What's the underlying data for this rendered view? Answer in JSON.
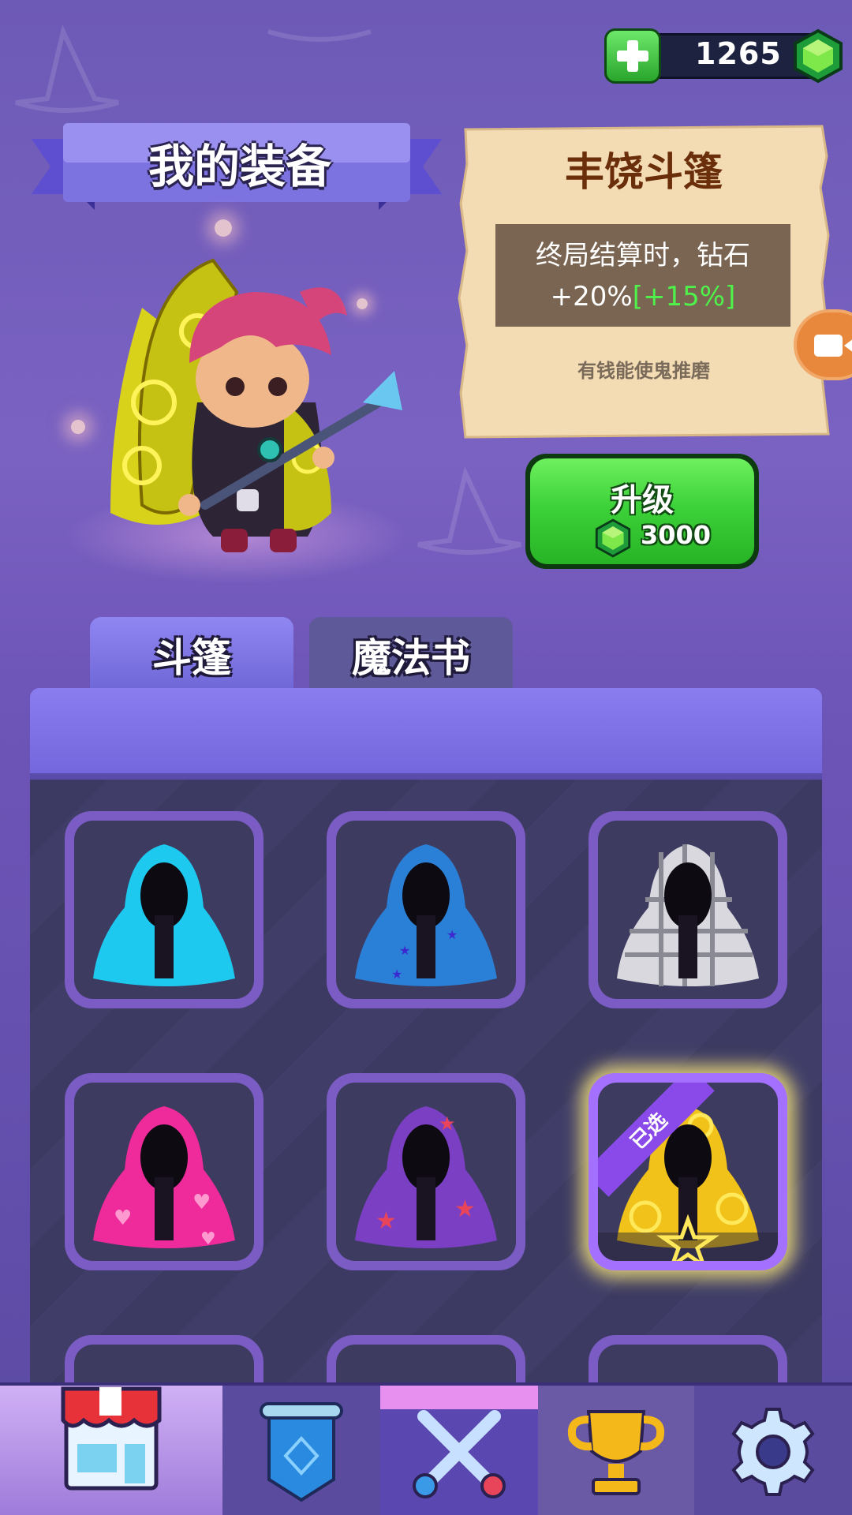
{
  "currency": {
    "gems": "1265",
    "add_label": "+"
  },
  "header": {
    "title": "我的装备"
  },
  "item_info": {
    "name": "丰饶斗篷",
    "description": "终局结算时，钻石",
    "bonus_base": "+20%",
    "bonus_extra": "[+15%]",
    "flavor": "有钱能使鬼推磨"
  },
  "upgrade": {
    "label": "升级",
    "cost": "3000"
  },
  "tabs": [
    {
      "label": "斗篷",
      "active": true
    },
    {
      "label": "魔法书",
      "active": false
    }
  ],
  "cloaks": [
    {
      "icon": "cyan-cloak-icon",
      "color": "#1ec9f0",
      "selected": false
    },
    {
      "icon": "blue-star-cloak-icon",
      "color": "#2a7fd6",
      "selected": false
    },
    {
      "icon": "plaid-cloak-icon",
      "color": "#cfcfd4",
      "selected": false
    },
    {
      "icon": "pink-heart-cloak-icon",
      "color": "#ef2a9a",
      "selected": false
    },
    {
      "icon": "purple-star-cloak-icon",
      "color": "#7b3fc4",
      "selected": false
    },
    {
      "icon": "gold-swirl-cloak-icon",
      "color": "#f0c21a",
      "selected": true,
      "tag": "已选"
    }
  ],
  "nav": [
    {
      "icon": "shop-icon",
      "active": true
    },
    {
      "icon": "banner-icon",
      "active": false
    },
    {
      "icon": "crossed-swords-icon",
      "active": false
    },
    {
      "icon": "trophy-icon",
      "active": false
    },
    {
      "icon": "gear-icon",
      "active": false
    }
  ],
  "colors": {
    "accent_green": "#3dd23a",
    "bonus_green": "#4ef24a",
    "panel_purple": "#7466dc"
  }
}
